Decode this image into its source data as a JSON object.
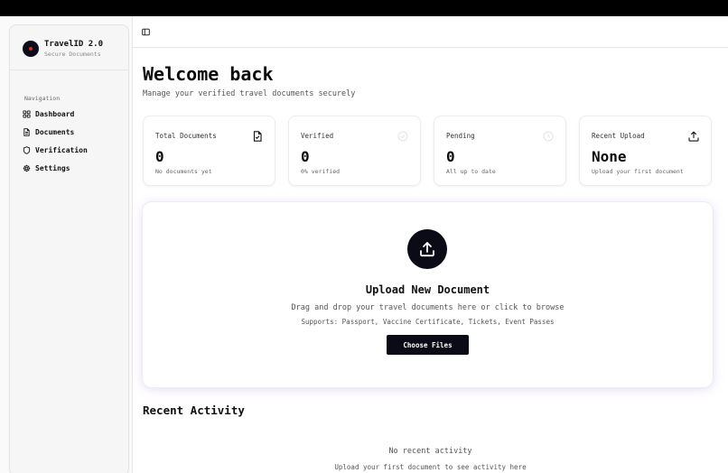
{
  "brand": {
    "title": "TravelID 2.0",
    "subtitle": "Secure Documents"
  },
  "nav": {
    "heading": "Navigation",
    "items": [
      {
        "label": "Dashboard",
        "icon": "grid-icon"
      },
      {
        "label": "Documents",
        "icon": "file-icon"
      },
      {
        "label": "Verification",
        "icon": "shield-icon"
      },
      {
        "label": "Settings",
        "icon": "gear-icon"
      }
    ]
  },
  "header": {
    "toggle_icon": "sidebar-toggle-icon"
  },
  "welcome": {
    "title": "Welcome back",
    "subtitle": "Manage your verified travel documents securely"
  },
  "stats": [
    {
      "label": "Total Documents",
      "value": "0",
      "note": "No documents yet",
      "icon": "file-check-icon"
    },
    {
      "label": "Verified",
      "value": "0",
      "note": "0% verified",
      "icon": "check-circle-icon"
    },
    {
      "label": "Pending",
      "value": "0",
      "note": "All up to date",
      "icon": "clock-icon"
    },
    {
      "label": "Recent Upload",
      "value": "None",
      "note": "Upload your first document",
      "icon": "upload-icon"
    }
  ],
  "upload": {
    "title": "Upload New Document",
    "description": "Drag and drop your travel documents here or click to browse",
    "supports": "Supports: Passport, Vaccine Certificate, Tickets, Event Passes",
    "button_label": "Choose Files",
    "icon": "upload-icon"
  },
  "recent": {
    "title": "Recent Activity",
    "empty_title": "No recent activity",
    "empty_subtitle": "Upload your first document to see activity here"
  },
  "colors": {
    "accent_dark": "#0b0b18",
    "brand_dot": "#d12b2b",
    "card_glow": "#e6dcfa"
  }
}
